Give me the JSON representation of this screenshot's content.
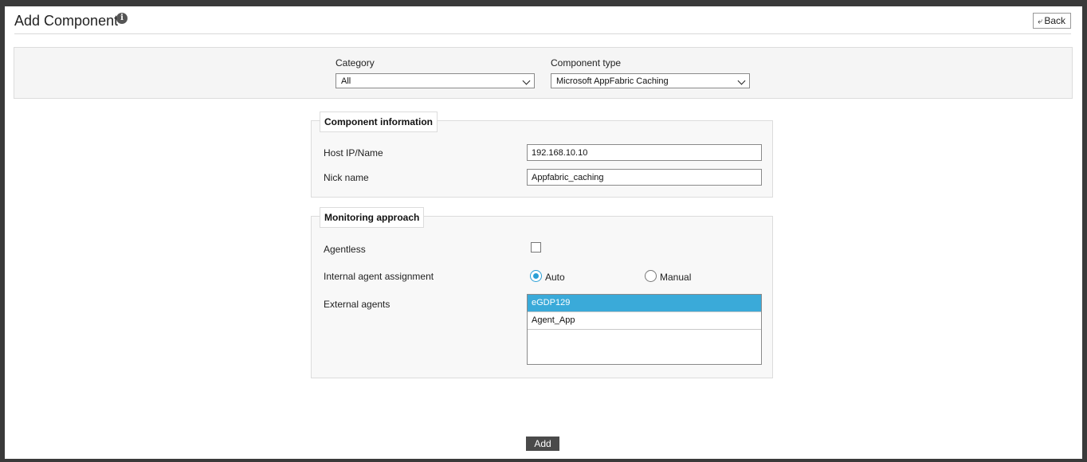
{
  "header": {
    "title": "Add Component",
    "back_label": "Back"
  },
  "filters": {
    "category_label": "Category",
    "category_value": "All",
    "component_type_label": "Component type",
    "component_type_value": "Microsoft AppFabric Caching"
  },
  "component_info": {
    "legend": "Component information",
    "host_label": "Host IP/Name",
    "host_value": "192.168.10.10",
    "nick_label": "Nick name",
    "nick_value": "Appfabric_caching"
  },
  "monitoring": {
    "legend": "Monitoring approach",
    "agentless_label": "Agentless",
    "agentless_checked": false,
    "internal_label": "Internal agent assignment",
    "option_auto": "Auto",
    "option_manual": "Manual",
    "selected_option": "Auto",
    "external_label": "External agents",
    "external_agents": [
      {
        "name": "eGDP129",
        "selected": true
      },
      {
        "name": "Agent_App",
        "selected": false
      }
    ]
  },
  "actions": {
    "add_label": "Add"
  },
  "colors": {
    "accent": "#3aaad9",
    "panel_bg": "#f5f5f5",
    "button_dark": "#4a4a4a"
  }
}
